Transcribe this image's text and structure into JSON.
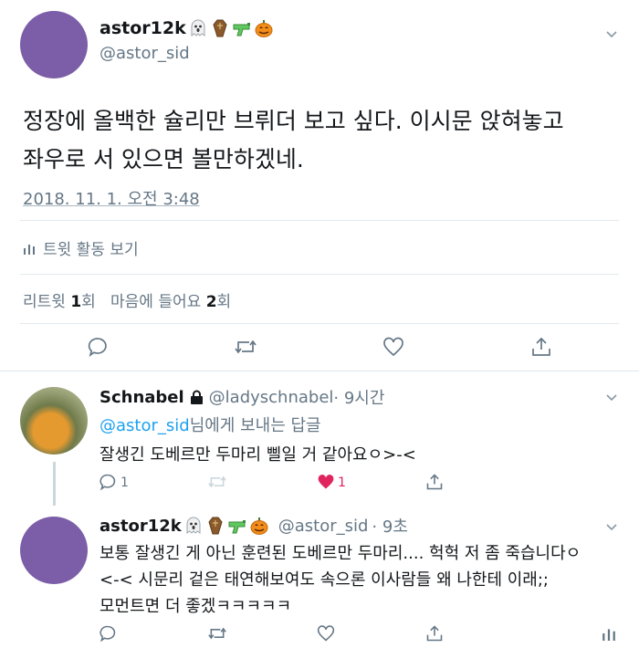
{
  "main_tweet": {
    "author_name": "astor12k",
    "author_handle": "@astor_sid",
    "text_line1": "정장에 올백한 슐리만 브뤼더 보고 싶다. 이시문 앉혀놓고",
    "text_line2": "좌우로 서 있으면 볼만하겠네.",
    "timestamp": "2018. 11. 1. 오전 3:48",
    "activity_label": "트윗 활동 보기",
    "retweet_label": "리트윗",
    "retweet_count": "1",
    "retweet_unit": "회",
    "like_label": "마음에 들어요",
    "like_count": "2",
    "like_unit": "회"
  },
  "reply1": {
    "author_name": "Schnabel",
    "author_handle": "@ladyschnabel",
    "time": "· 9시간",
    "reply_to_mention": "@astor_sid",
    "reply_to_suffix": "님에게 보내는 답글",
    "text": "잘생긴 도베르만 두마리 삘일 거 같아요ㅇ>-<",
    "reply_count": "1",
    "like_count": "1"
  },
  "reply2": {
    "author_name": "astor12k",
    "author_handle": "@astor_sid",
    "time": "· 9초",
    "text_line1": "보통 잘생긴 게 아닌 훈련된 도베르만 두마리.... 헉헉 저 좀 죽습니다ㅇ",
    "text_line2": "<-< 시문리 겉은 태연해보여도 속으론 이사람들 왜 나한테 이래;;",
    "text_line3": "모먼트면 더 좋겠ㅋㅋㅋㅋㅋ"
  },
  "icons": {
    "name_emojis": [
      "ghost-icon",
      "coffin-icon",
      "water-gun-icon",
      "pumpkin-icon"
    ],
    "actions": [
      "reply-icon",
      "retweet-icon",
      "like-icon",
      "share-icon"
    ]
  },
  "colors": {
    "accent": "#1da1f2",
    "like": "#e0245e",
    "muted": "#657786",
    "avatar": "#7b5ea7"
  }
}
